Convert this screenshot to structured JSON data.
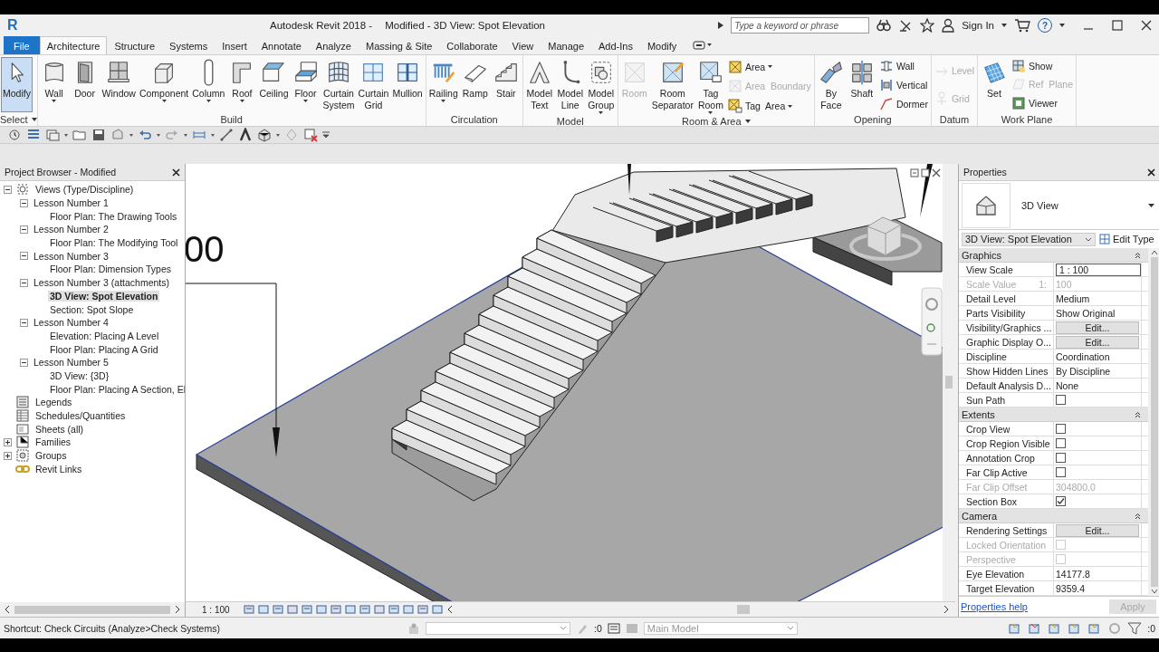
{
  "title_bar": {
    "logo": "R",
    "app_title": "Autodesk Revit 2018 -",
    "document_title": "Modified - 3D View: Spot Elevation",
    "search": {
      "placeholder": "Type a keyword or phrase"
    },
    "sign_in": "Sign In",
    "help": "?"
  },
  "tabs": [
    {
      "label": "File",
      "kind": "file",
      "selected": false
    },
    {
      "label": "Architecture",
      "kind": "tab",
      "selected": true
    },
    {
      "label": "Structure",
      "kind": "tab",
      "selected": false
    },
    {
      "label": "Systems",
      "kind": "tab",
      "selected": false
    },
    {
      "label": "Insert",
      "kind": "tab",
      "selected": false
    },
    {
      "label": "Annotate",
      "kind": "tab",
      "selected": false
    },
    {
      "label": "Analyze",
      "kind": "tab",
      "selected": false
    },
    {
      "label": "Massing & Site",
      "kind": "tab",
      "selected": false
    },
    {
      "label": "Collaborate",
      "kind": "tab",
      "selected": false
    },
    {
      "label": "View",
      "kind": "tab",
      "selected": false
    },
    {
      "label": "Manage",
      "kind": "tab",
      "selected": false
    },
    {
      "label": "Add-Ins",
      "kind": "tab",
      "selected": false
    },
    {
      "label": "Modify",
      "kind": "tab",
      "selected": false
    }
  ],
  "ribbon": [
    {
      "title": "Select",
      "title_dropdown": true,
      "tools": [
        {
          "label": "Modify",
          "dropdown": false,
          "disabled": false,
          "selected": true
        }
      ]
    },
    {
      "title": "Build",
      "title_dropdown": false,
      "tools": [
        {
          "label": "Wall",
          "dropdown": true,
          "disabled": false,
          "selected": false
        },
        {
          "label": "Door",
          "dropdown": false,
          "disabled": false,
          "selected": false
        },
        {
          "label": "Window",
          "dropdown": false,
          "disabled": false,
          "selected": false
        },
        {
          "label": "Component",
          "dropdown": true,
          "disabled": false,
          "selected": false
        },
        {
          "label": "Column",
          "dropdown": true,
          "disabled": false,
          "selected": false
        },
        {
          "label": "Roof",
          "dropdown": true,
          "disabled": false,
          "selected": false
        },
        {
          "label": "Ceiling",
          "dropdown": false,
          "disabled": false,
          "selected": false
        },
        {
          "label": "Floor",
          "dropdown": true,
          "disabled": false,
          "selected": false
        },
        {
          "label": "Curtain\nSystem",
          "dropdown": false,
          "disabled": false,
          "selected": false
        },
        {
          "label": "Curtain\nGrid",
          "dropdown": false,
          "disabled": false,
          "selected": false
        },
        {
          "label": "Mullion",
          "dropdown": false,
          "disabled": false,
          "selected": false
        }
      ]
    },
    {
      "title": "Circulation",
      "title_dropdown": false,
      "tools": [
        {
          "label": "Railing",
          "dropdown": true,
          "disabled": false,
          "selected": false
        },
        {
          "label": "Ramp",
          "dropdown": false,
          "disabled": false,
          "selected": false
        },
        {
          "label": "Stair",
          "dropdown": false,
          "disabled": false,
          "selected": false
        }
      ]
    },
    {
      "title": "Model",
      "title_dropdown": false,
      "tools": [
        {
          "label": "Model\nText",
          "dropdown": false,
          "disabled": false,
          "selected": false
        },
        {
          "label": "Model\nLine",
          "dropdown": false,
          "disabled": false,
          "selected": false
        },
        {
          "label": "Model\nGroup",
          "dropdown": true,
          "disabled": false,
          "selected": false
        }
      ]
    },
    {
      "title": "Room & Area",
      "title_dropdown": true,
      "tools": [
        {
          "label": "Room",
          "dropdown": false,
          "disabled": true,
          "selected": false
        },
        {
          "label": "Room\nSeparator",
          "dropdown": false,
          "disabled": false,
          "selected": false
        },
        {
          "label": "Tag\nRoom",
          "dropdown": true,
          "disabled": false,
          "selected": false
        }
      ],
      "small_tools": [
        {
          "label": "Area",
          "dropdown": true,
          "disabled": false
        },
        {
          "label": "Area  Boundary",
          "dropdown": false,
          "disabled": true
        },
        {
          "label": "Tag  Area",
          "dropdown": true,
          "disabled": false
        }
      ]
    },
    {
      "title": "Opening",
      "title_dropdown": false,
      "tools": [
        {
          "label": "By\nFace",
          "dropdown": false,
          "disabled": false,
          "selected": false
        },
        {
          "label": "Shaft",
          "dropdown": false,
          "disabled": false,
          "selected": false
        }
      ],
      "small_tools": [
        {
          "label": "Wall",
          "dropdown": false,
          "disabled": false
        },
        {
          "label": "Vertical",
          "dropdown": false,
          "disabled": false
        },
        {
          "label": "Dormer",
          "dropdown": false,
          "disabled": false
        }
      ]
    },
    {
      "title": "Datum",
      "title_dropdown": false,
      "small_tools": [
        {
          "label": "Level",
          "dropdown": false,
          "disabled": true
        },
        {
          "label": "Grid",
          "dropdown": false,
          "disabled": true
        }
      ]
    },
    {
      "title": "Work Plane",
      "title_dropdown": false,
      "tools": [
        {
          "label": "Set",
          "dropdown": false,
          "disabled": false,
          "selected": false
        }
      ],
      "small_tools": [
        {
          "label": "Show",
          "dropdown": false,
          "disabled": false
        },
        {
          "label": "Ref  Plane",
          "dropdown": false,
          "disabled": true
        },
        {
          "label": "Viewer",
          "dropdown": false,
          "disabled": false
        }
      ]
    }
  ],
  "browser": {
    "title": "Project Browser - Modified",
    "items": [
      {
        "label": "Views (Type/Discipline)",
        "expanded": true,
        "selected": false,
        "children": [
          {
            "label": "Lesson Number 1",
            "expanded": true,
            "selected": false,
            "children": [
              {
                "label": "Floor Plan: The Drawing Tools",
                "selected": false
              }
            ]
          },
          {
            "label": "Lesson Number 2",
            "expanded": true,
            "selected": false,
            "children": [
              {
                "label": "Floor Plan: The Modifying Tool",
                "selected": false
              }
            ]
          },
          {
            "label": "Lesson Number 3",
            "expanded": true,
            "selected": false,
            "children": [
              {
                "label": "Floor Plan: Dimension Types",
                "selected": false
              }
            ]
          },
          {
            "label": "Lesson Number 3 (attachments)",
            "expanded": true,
            "selected": false,
            "children": [
              {
                "label": "3D View: Spot Elevation",
                "selected": true
              },
              {
                "label": "Section: Spot Slope",
                "selected": false
              }
            ]
          },
          {
            "label": "Lesson Number 4",
            "expanded": true,
            "selected": false,
            "children": [
              {
                "label": "Elevation: Placing A Level",
                "selected": false
              },
              {
                "label": "Floor Plan: Placing A Grid",
                "selected": false
              }
            ]
          },
          {
            "label": "Lesson Number 5",
            "expanded": true,
            "selected": false,
            "children": [
              {
                "label": "3D View: {3D}",
                "selected": false
              },
              {
                "label": "Floor Plan: Placing A Section, El",
                "selected": false
              }
            ]
          }
        ]
      },
      {
        "label": "Legends",
        "selected": false
      },
      {
        "label": "Schedules/Quantities",
        "selected": false
      },
      {
        "label": "Sheets (all)",
        "selected": false
      },
      {
        "label": "Families",
        "expanded": false,
        "selected": false
      },
      {
        "label": "Groups",
        "expanded": false,
        "selected": false
      },
      {
        "label": "Revit Links",
        "selected": false
      }
    ]
  },
  "viewport": {
    "annotation": "00",
    "scale": "1 : 100"
  },
  "properties": {
    "title": "Properties",
    "type_name": "3D View",
    "instance": "3D View: Spot Elevation",
    "edit_type": "Edit Type",
    "sections": [
      {
        "title": "Graphics",
        "expanded": true,
        "rows": [
          {
            "label": "View Scale",
            "value": "1 : 100",
            "kind": "input",
            "disabled": false
          },
          {
            "label": "Scale Value",
            "label_suffix": "1:",
            "value": "100",
            "kind": "text",
            "disabled": true
          },
          {
            "label": "Detail Level",
            "value": "Medium",
            "kind": "text",
            "disabled": false
          },
          {
            "label": "Parts Visibility",
            "value": "Show Original",
            "kind": "text",
            "disabled": false
          },
          {
            "label": "Visibility/Graphics ...",
            "value": "Edit...",
            "kind": "button",
            "disabled": false
          },
          {
            "label": "Graphic Display O...",
            "value": "Edit...",
            "kind": "button",
            "disabled": false
          },
          {
            "label": "Discipline",
            "value": "Coordination",
            "kind": "text",
            "disabled": false
          },
          {
            "label": "Show Hidden Lines",
            "value": "By Discipline",
            "kind": "text",
            "disabled": false
          },
          {
            "label": "Default Analysis D...",
            "value": "None",
            "kind": "text",
            "disabled": false
          },
          {
            "label": "Sun Path",
            "kind": "checkbox",
            "checked": false,
            "disabled": false
          }
        ]
      },
      {
        "title": "Extents",
        "expanded": true,
        "rows": [
          {
            "label": "Crop View",
            "kind": "checkbox",
            "checked": false,
            "disabled": false
          },
          {
            "label": "Crop Region Visible",
            "kind": "checkbox",
            "checked": false,
            "disabled": false
          },
          {
            "label": "Annotation Crop",
            "kind": "checkbox",
            "checked": false,
            "disabled": false
          },
          {
            "label": "Far Clip Active",
            "kind": "checkbox",
            "checked": false,
            "disabled": false
          },
          {
            "label": "Far Clip Offset",
            "value": "304800.0",
            "kind": "text",
            "disabled": true
          },
          {
            "label": "Section Box",
            "kind": "checkbox",
            "checked": true,
            "disabled": false
          }
        ]
      },
      {
        "title": "Camera",
        "expanded": true,
        "rows": [
          {
            "label": "Rendering Settings",
            "value": "Edit...",
            "kind": "button",
            "disabled": false
          },
          {
            "label": "Locked Orientation",
            "kind": "checkbox",
            "checked": false,
            "disabled": true
          },
          {
            "label": "Perspective",
            "kind": "checkbox",
            "checked": false,
            "disabled": true
          },
          {
            "label": "Eye Elevation",
            "value": "14177.8",
            "kind": "text",
            "disabled": false
          },
          {
            "label": "Target Elevation",
            "value": "9359.4",
            "kind": "text",
            "disabled": false
          }
        ]
      }
    ],
    "help_link": "Properties help",
    "apply": "Apply",
    "apply_disabled": true
  },
  "status_bar": {
    "hint": "Shortcut: Check Circuits (Analyze>Check Systems)",
    "editable_count": ":0",
    "active_model": "Main Model",
    "filter_count": ":0"
  }
}
